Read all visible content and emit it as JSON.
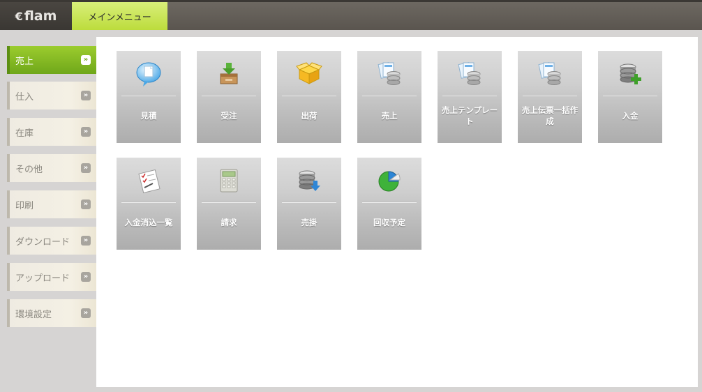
{
  "app": {
    "logo_text": "flam",
    "logo_icon": "c-logo-icon",
    "active_tab": "メインメニュー"
  },
  "sidebar": {
    "items": [
      {
        "label": "売上",
        "active": true
      },
      {
        "label": "仕入",
        "active": false
      },
      {
        "label": "在庫",
        "active": false
      },
      {
        "label": "その他",
        "active": false
      },
      {
        "label": "印刷",
        "active": false
      },
      {
        "label": "ダウンロード",
        "active": false
      },
      {
        "label": "アップロード",
        "active": false
      },
      {
        "label": "環境設定",
        "active": false
      }
    ],
    "chevron_glyph": "»"
  },
  "tiles": [
    {
      "label": "見積",
      "icon": "speech-document-icon"
    },
    {
      "label": "受注",
      "icon": "inbox-download-icon"
    },
    {
      "label": "出荷",
      "icon": "open-box-icon"
    },
    {
      "label": "売上",
      "icon": "documents-database-icon"
    },
    {
      "label": "売上テンプレート",
      "icon": "documents-database-icon"
    },
    {
      "label": "売上伝票一括作成",
      "icon": "documents-database-icon"
    },
    {
      "label": "入金",
      "icon": "database-add-icon"
    },
    {
      "label": "入金消込一覧",
      "icon": "checklist-icon"
    },
    {
      "label": "請求",
      "icon": "calculator-icon"
    },
    {
      "label": "売掛",
      "icon": "database-download-icon"
    },
    {
      "label": "回収予定",
      "icon": "pie-chart-icon"
    }
  ],
  "colors": {
    "accent_green": "#8cc026",
    "tab_yellow_green": "#c9e44f",
    "topbar": "#5f5a54"
  }
}
